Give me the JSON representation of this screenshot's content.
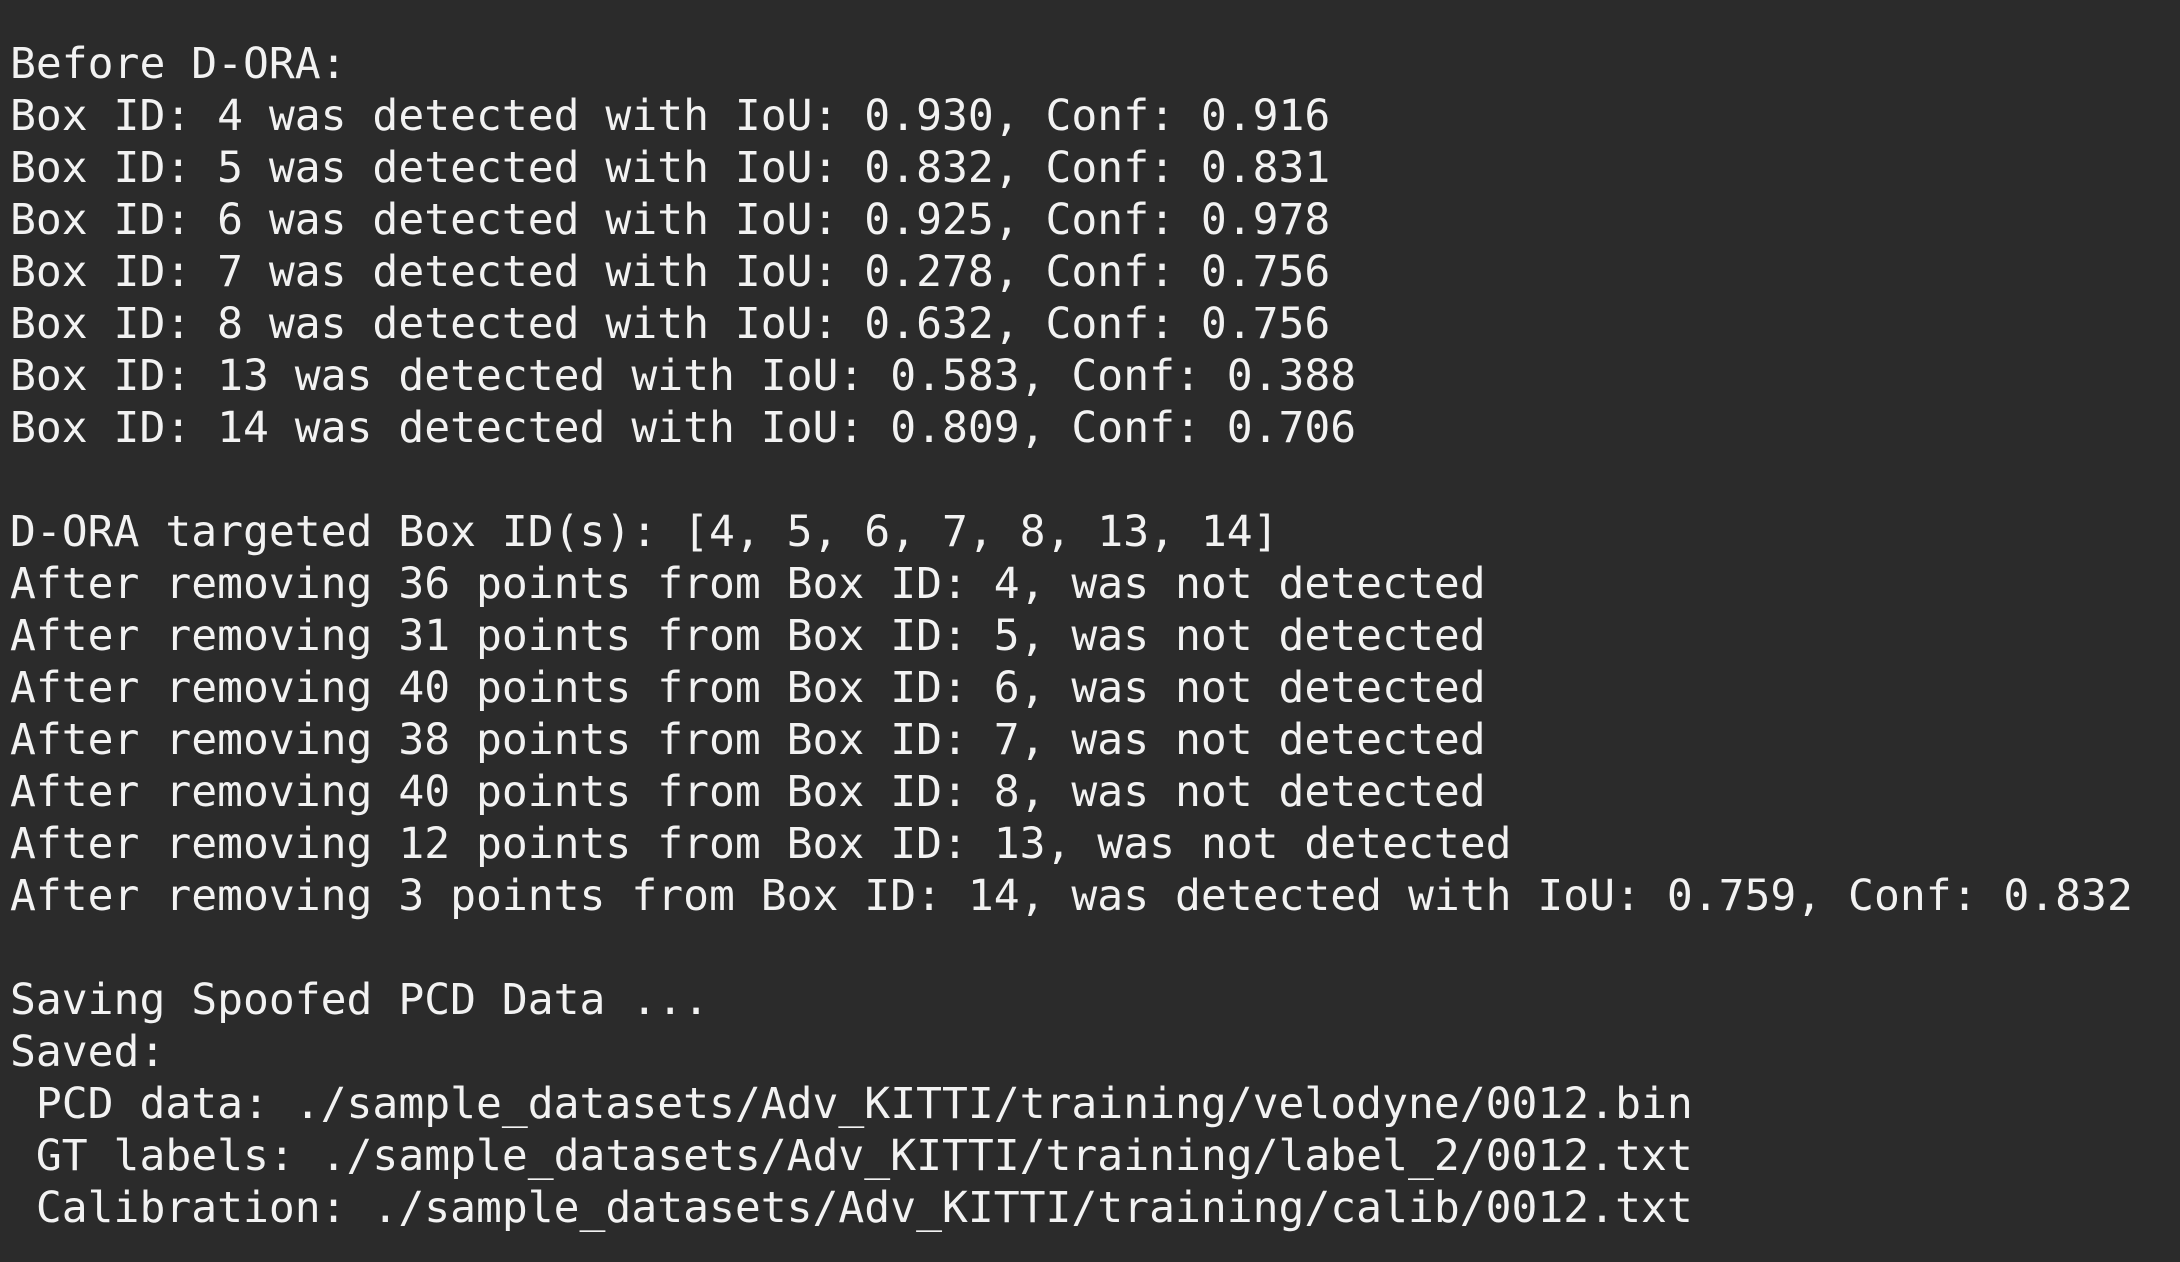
{
  "terminal": {
    "lines": [
      "Before D-ORA:",
      "Box ID: 4 was detected with IoU: 0.930, Conf: 0.916",
      "Box ID: 5 was detected with IoU: 0.832, Conf: 0.831",
      "Box ID: 6 was detected with IoU: 0.925, Conf: 0.978",
      "Box ID: 7 was detected with IoU: 0.278, Conf: 0.756",
      "Box ID: 8 was detected with IoU: 0.632, Conf: 0.756",
      "Box ID: 13 was detected with IoU: 0.583, Conf: 0.388",
      "Box ID: 14 was detected with IoU: 0.809, Conf: 0.706",
      "",
      "D-ORA targeted Box ID(s): [4, 5, 6, 7, 8, 13, 14]",
      "After removing 36 points from Box ID: 4, was not detected",
      "After removing 31 points from Box ID: 5, was not detected",
      "After removing 40 points from Box ID: 6, was not detected",
      "After removing 38 points from Box ID: 7, was not detected",
      "After removing 40 points from Box ID: 8, was not detected",
      "After removing 12 points from Box ID: 13, was not detected",
      "After removing 3 points from Box ID: 14, was detected with IoU: 0.759, Conf: 0.832",
      "",
      "Saving Spoofed PCD Data ...",
      "Saved:",
      " PCD data: ./sample_datasets/Adv_KITTI/training/velodyne/0012.bin",
      " GT labels: ./sample_datasets/Adv_KITTI/training/label_2/0012.txt",
      " Calibration: ./sample_datasets/Adv_KITTI/training/calib/0012.txt"
    ]
  },
  "colors": {
    "background": "#2b2b2b",
    "text": "#f2f2f2"
  }
}
